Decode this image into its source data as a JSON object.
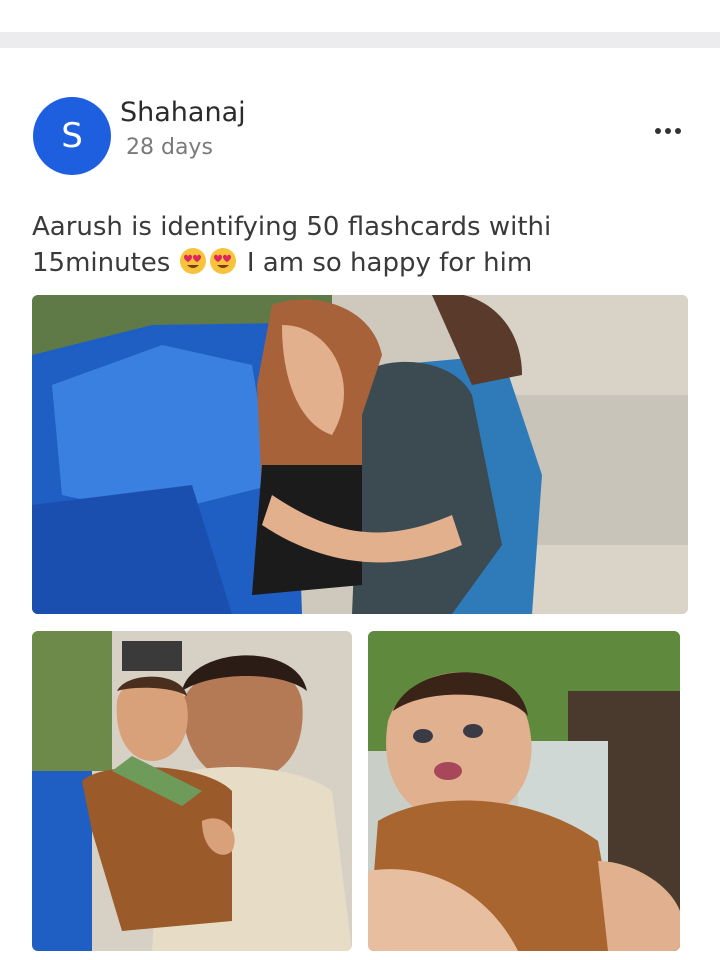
{
  "post": {
    "author": {
      "initial": "S",
      "name": "Shahanaj",
      "avatar_color": "#1e5fe0"
    },
    "time": "28 days",
    "text_part1": "Aarush is identifying 50 flashcards withi 15minutes ",
    "emojis": [
      "heart-eyes-emoji",
      "heart-eyes-emoji"
    ],
    "text_part2": " I am so happy for him",
    "more_icon": "more-horizontal-icon",
    "photos": [
      {
        "description": "woman-holding-baby-near-blue-tarp"
      },
      {
        "description": "man-holding-baby"
      },
      {
        "description": "baby-closeup"
      }
    ]
  }
}
